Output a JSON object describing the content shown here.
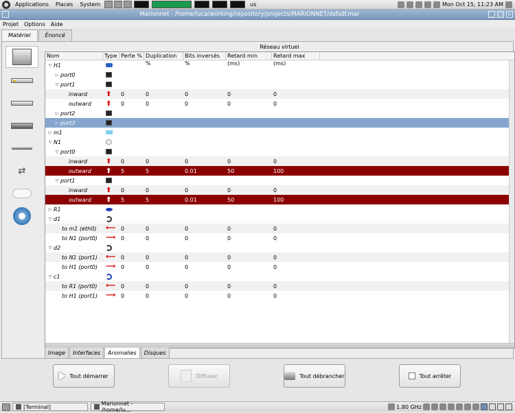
{
  "top_panel": {
    "menus": [
      "Applications",
      "Places",
      "System"
    ],
    "keyboard_layout": "us",
    "clock": "Mon Oct 15, 11:23 AM"
  },
  "window": {
    "title": "Marionnet - /home/luca/working/repository/projects/MARIONNET/dsfsdf.mar"
  },
  "menubar": [
    "Projet",
    "Options",
    "Aide"
  ],
  "top_tabs": [
    "Matériel",
    "Énoncé"
  ],
  "palette": [
    "machine",
    "hub",
    "switch",
    "router",
    "cable-straight",
    "cable-crossed",
    "cloud",
    "world-gateway"
  ],
  "network_title": "Réseau virtuel",
  "columns": [
    "Nom",
    "Type",
    "Perte %",
    "Duplication %",
    "Bits inversés %",
    "Retard min (ms)",
    "Retard max (ms)"
  ],
  "rows": [
    {
      "level": 0,
      "expander": "open",
      "name": "H1",
      "type": "pc",
      "vals": [
        "",
        "",
        "",
        "",
        ""
      ],
      "style": ""
    },
    {
      "level": 1,
      "expander": "closed",
      "name": "port0",
      "type": "eth",
      "vals": [
        "",
        "",
        "",
        "",
        ""
      ],
      "style": ""
    },
    {
      "level": 1,
      "expander": "open",
      "name": "port1",
      "type": "eth",
      "vals": [
        "",
        "",
        "",
        "",
        ""
      ],
      "style": ""
    },
    {
      "level": 2,
      "expander": "none",
      "name": "inward",
      "type": "arrow-up",
      "vals": [
        "0",
        "0",
        "0",
        "0",
        "0"
      ],
      "style": "alt"
    },
    {
      "level": 2,
      "expander": "none",
      "name": "outward",
      "type": "arrow-up",
      "vals": [
        "0",
        "0",
        "0",
        "0",
        "0"
      ],
      "style": ""
    },
    {
      "level": 1,
      "expander": "closed",
      "name": "port2",
      "type": "eth",
      "vals": [
        "",
        "",
        "",
        "",
        ""
      ],
      "style": ""
    },
    {
      "level": 1,
      "expander": "closed",
      "name": "port3",
      "type": "eth",
      "vals": [
        "",
        "",
        "",
        "",
        ""
      ],
      "style": "sel-blue"
    },
    {
      "level": 0,
      "expander": "closed",
      "name": "m1",
      "type": "pc2",
      "vals": [
        "",
        "",
        "",
        "",
        ""
      ],
      "style": ""
    },
    {
      "level": 0,
      "expander": "open",
      "name": "N1",
      "type": "hub",
      "vals": [
        "",
        "",
        "",
        "",
        ""
      ],
      "style": ""
    },
    {
      "level": 1,
      "expander": "open",
      "name": "port0",
      "type": "eth",
      "vals": [
        "",
        "",
        "",
        "",
        ""
      ],
      "style": ""
    },
    {
      "level": 2,
      "expander": "none",
      "name": "inward",
      "type": "arrow-up",
      "vals": [
        "0",
        "0",
        "0",
        "0",
        "0"
      ],
      "style": "alt"
    },
    {
      "level": 2,
      "expander": "none",
      "name": "outward",
      "type": "arrow-up",
      "vals": [
        "5",
        "5",
        "0.01",
        "50",
        "100"
      ],
      "style": "sel-red"
    },
    {
      "level": 1,
      "expander": "open",
      "name": "port1",
      "type": "eth",
      "vals": [
        "",
        "",
        "",
        "",
        ""
      ],
      "style": ""
    },
    {
      "level": 2,
      "expander": "none",
      "name": "inward",
      "type": "arrow-up",
      "vals": [
        "0",
        "0",
        "0",
        "0",
        "0"
      ],
      "style": "alt"
    },
    {
      "level": 2,
      "expander": "none",
      "name": "outward",
      "type": "arrow-up",
      "vals": [
        "5",
        "5",
        "0.01",
        "50",
        "100"
      ],
      "style": "sel-red"
    },
    {
      "level": 0,
      "expander": "closed",
      "name": "R1",
      "type": "router",
      "vals": [
        "",
        "",
        "",
        "",
        ""
      ],
      "style": ""
    },
    {
      "level": 0,
      "expander": "open",
      "name": "d1",
      "type": "cable",
      "vals": [
        "",
        "",
        "",
        "",
        ""
      ],
      "style": ""
    },
    {
      "level": 1,
      "expander": "none",
      "name": "to m1 (eth0)",
      "type": "arrow-left",
      "vals": [
        "0",
        "0",
        "0",
        "0",
        "0"
      ],
      "style": "alt"
    },
    {
      "level": 1,
      "expander": "none",
      "name": "to N1 (port0)",
      "type": "arrow-right",
      "vals": [
        "0",
        "0",
        "0",
        "0",
        "0"
      ],
      "style": ""
    },
    {
      "level": 0,
      "expander": "open",
      "name": "d2",
      "type": "cable",
      "vals": [
        "",
        "",
        "",
        "",
        ""
      ],
      "style": ""
    },
    {
      "level": 1,
      "expander": "none",
      "name": "to N1 (port1)",
      "type": "arrow-left",
      "vals": [
        "0",
        "0",
        "0",
        "0",
        "0"
      ],
      "style": "alt"
    },
    {
      "level": 1,
      "expander": "none",
      "name": "to H1 (port0)",
      "type": "arrow-right",
      "vals": [
        "0",
        "0",
        "0",
        "0",
        "0"
      ],
      "style": ""
    },
    {
      "level": 0,
      "expander": "open",
      "name": "c1",
      "type": "cable-blue",
      "vals": [
        "",
        "",
        "",
        "",
        ""
      ],
      "style": ""
    },
    {
      "level": 1,
      "expander": "none",
      "name": "to R1 (port0)",
      "type": "arrow-left",
      "vals": [
        "0",
        "0",
        "0",
        "0",
        "0"
      ],
      "style": "alt"
    },
    {
      "level": 1,
      "expander": "none",
      "name": "to H1 (port1)",
      "type": "arrow-right",
      "vals": [
        "0",
        "0",
        "0",
        "0",
        "0"
      ],
      "style": ""
    }
  ],
  "bottom_tabs": [
    "Image",
    "Interfaces",
    "Anomalies",
    "Disques"
  ],
  "active_bottom_tab": "Anomalies",
  "actions": {
    "start": "Tout démarrer",
    "diffuse": "Diffuser",
    "unplug": "Tout débrancher",
    "stop": "Tout arrêter"
  },
  "taskbar": {
    "terminal": "[Terminal]",
    "marionnet": "Marionnet - /home/lu...",
    "cpu": "1.80 GHz"
  },
  "colors": {
    "selected_blue": "#86a6cf",
    "selected_red": "#8b0000",
    "titlebar": "#7a98bb"
  }
}
